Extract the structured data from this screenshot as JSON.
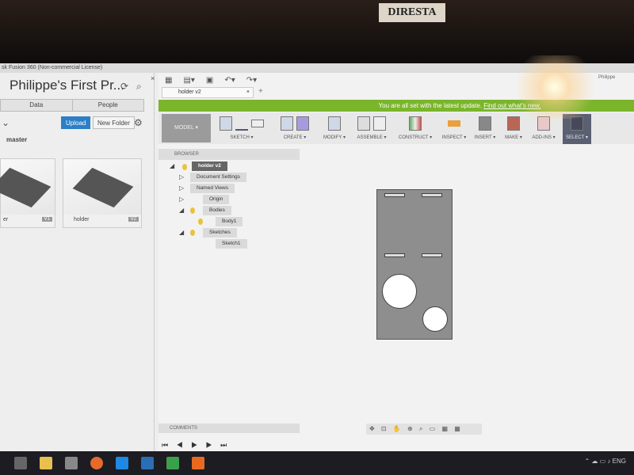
{
  "window_title": "sk Fusion 360 (Non-commercial License)",
  "sign": "DIRESTA",
  "data_panel": {
    "project_title": "Philippe's First Pr...",
    "tabs": [
      "Data",
      "People"
    ],
    "upload": "Upload",
    "new_folder": "New Folder",
    "branch": "master",
    "files": [
      {
        "name": "er",
        "version": "V1"
      },
      {
        "name": "holder",
        "version": "V2"
      }
    ]
  },
  "app": {
    "doc_tab": "holder v2",
    "user": "Philippe",
    "banner_text": "You are all set with the latest update.",
    "banner_link": "Find out what's new.",
    "workspace": "MODEL ▾",
    "ribbon_groups": [
      "SKETCH ▾",
      "CREATE ▾",
      "MODIFY ▾",
      "ASSEMBLE ▾",
      "CONSTRUCT ▾",
      "INSPECT ▾",
      "INSERT ▾",
      "MAKE ▾",
      "ADD-INS ▾",
      "SELECT ▾"
    ],
    "browser_label": "BROWSER",
    "comments_label": "COMMENTS",
    "tree": [
      "holder v2",
      "Document Settings",
      "Named Views",
      "Origin",
      "Bodies",
      "Body1",
      "Sketches",
      "Sketch1"
    ]
  },
  "timeline": "⏮ ◀ ▶ ▶ ⏭",
  "tray": {
    "lang": "ENG"
  }
}
